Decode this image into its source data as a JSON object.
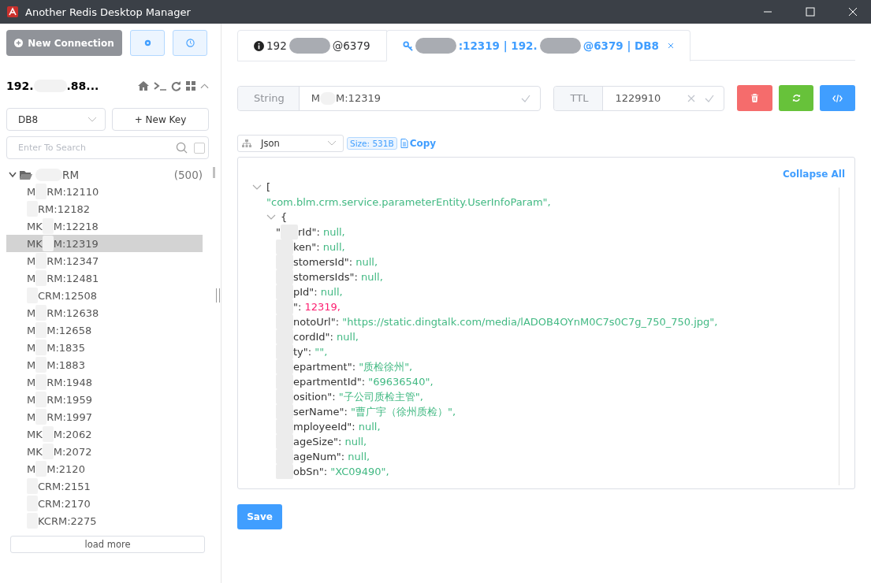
{
  "window": {
    "title": "Another Redis Desktop Manager"
  },
  "sidebar": {
    "new_connection": "New Connection",
    "connection": {
      "name": [
        {
          "kind": "text",
          "text": "192."
        },
        {
          "kind": "redaction",
          "color": "#f2f2f2"
        },
        {
          "kind": "text",
          "text": ".88..."
        }
      ],
      "expanded": true
    },
    "db_select": {
      "value": "DB8"
    },
    "new_key": "+ New Key",
    "search": {
      "placeholder": "Enter To Search",
      "exact": false
    },
    "folder": {
      "name": [
        {
          "kind": "redaction",
          "color": "#f2f2f2"
        },
        {
          "kind": "text",
          "text": "RM"
        }
      ],
      "count": "(500)",
      "expanded": true
    },
    "keys": [
      {
        "name": [
          {
            "kind": "text",
            "text": "M"
          },
          {
            "kind": "redaction",
            "color": "#f2f2f2"
          },
          {
            "kind": "text",
            "text": "RM:12110"
          }
        ],
        "selected": false
      },
      {
        "name": [
          {
            "kind": "redaction",
            "color": "#f2f2f2"
          },
          {
            "kind": "text",
            "text": "RM:12182"
          }
        ],
        "selected": false
      },
      {
        "name": [
          {
            "kind": "text",
            "text": "MK"
          },
          {
            "kind": "redaction",
            "color": "#f2f2f2"
          },
          {
            "kind": "text",
            "text": "M:12218"
          }
        ],
        "selected": false
      },
      {
        "name": [
          {
            "kind": "text",
            "text": "MK"
          },
          {
            "kind": "redaction",
            "color": "#f2f2f2"
          },
          {
            "kind": "text",
            "text": "M:12319"
          }
        ],
        "selected": true
      },
      {
        "name": [
          {
            "kind": "text",
            "text": "M"
          },
          {
            "kind": "redaction",
            "color": "#f2f2f2"
          },
          {
            "kind": "text",
            "text": "RM:12347"
          }
        ],
        "selected": false
      },
      {
        "name": [
          {
            "kind": "text",
            "text": "M"
          },
          {
            "kind": "redaction",
            "color": "#f2f2f2"
          },
          {
            "kind": "text",
            "text": "RM:12481"
          }
        ],
        "selected": false
      },
      {
        "name": [
          {
            "kind": "redaction",
            "color": "#f2f2f2"
          },
          {
            "kind": "text",
            "text": "CRM:12508"
          }
        ],
        "selected": false
      },
      {
        "name": [
          {
            "kind": "text",
            "text": "M"
          },
          {
            "kind": "redaction",
            "color": "#f2f2f2"
          },
          {
            "kind": "text",
            "text": "RM:12638"
          }
        ],
        "selected": false
      },
      {
        "name": [
          {
            "kind": "text",
            "text": "M"
          },
          {
            "kind": "redaction",
            "color": "#f2f2f2"
          },
          {
            "kind": "text",
            "text": "M:12658"
          }
        ],
        "selected": false
      },
      {
        "name": [
          {
            "kind": "text",
            "text": "M"
          },
          {
            "kind": "redaction",
            "color": "#f2f2f2"
          },
          {
            "kind": "text",
            "text": "M:1835"
          }
        ],
        "selected": false
      },
      {
        "name": [
          {
            "kind": "text",
            "text": "M"
          },
          {
            "kind": "redaction",
            "color": "#f2f2f2"
          },
          {
            "kind": "text",
            "text": "M:1883"
          }
        ],
        "selected": false
      },
      {
        "name": [
          {
            "kind": "text",
            "text": "M"
          },
          {
            "kind": "redaction",
            "color": "#f2f2f2"
          },
          {
            "kind": "text",
            "text": "RM:1948"
          }
        ],
        "selected": false
      },
      {
        "name": [
          {
            "kind": "text",
            "text": "M"
          },
          {
            "kind": "redaction",
            "color": "#f2f2f2"
          },
          {
            "kind": "text",
            "text": "RM:1959"
          }
        ],
        "selected": false
      },
      {
        "name": [
          {
            "kind": "text",
            "text": "M"
          },
          {
            "kind": "redaction",
            "color": "#f2f2f2"
          },
          {
            "kind": "text",
            "text": "RM:1997"
          }
        ],
        "selected": false
      },
      {
        "name": [
          {
            "kind": "text",
            "text": "MK"
          },
          {
            "kind": "redaction",
            "color": "#f2f2f2"
          },
          {
            "kind": "text",
            "text": "M:2062"
          }
        ],
        "selected": false
      },
      {
        "name": [
          {
            "kind": "text",
            "text": "MK"
          },
          {
            "kind": "redaction",
            "color": "#f2f2f2"
          },
          {
            "kind": "text",
            "text": "M:2072"
          }
        ],
        "selected": false
      },
      {
        "name": [
          {
            "kind": "text",
            "text": "M"
          },
          {
            "kind": "redaction",
            "color": "#f2f2f2"
          },
          {
            "kind": "text",
            "text": "M:2120"
          }
        ],
        "selected": false
      },
      {
        "name": [
          {
            "kind": "redaction",
            "color": "#f2f2f2"
          },
          {
            "kind": "text",
            "text": "CRM:2151"
          }
        ],
        "selected": false
      },
      {
        "name": [
          {
            "kind": "redaction",
            "color": "#f2f2f2"
          },
          {
            "kind": "text",
            "text": "CRM:2170"
          }
        ],
        "selected": false
      },
      {
        "name": [
          {
            "kind": "redaction",
            "color": "#f2f2f2"
          },
          {
            "kind": "text",
            "text": "KCRM:2275"
          }
        ],
        "selected": false
      }
    ],
    "load_more": "load more"
  },
  "tabs": [
    {
      "kind": "info",
      "label": [
        {
          "kind": "text",
          "text": "192"
        },
        {
          "kind": "redaction",
          "color": "#a9acb2"
        },
        {
          "kind": "text",
          "text": "@6379"
        }
      ],
      "selected": false,
      "closable": false
    },
    {
      "kind": "key",
      "label": [
        {
          "kind": "redaction",
          "color": "#a9acb2"
        },
        {
          "kind": "text",
          "text": ":12319 | 192."
        },
        {
          "kind": "redaction",
          "color": "#a9acb2"
        },
        {
          "kind": "text",
          "text": "@6379 | DB8"
        }
      ],
      "selected": true,
      "closable": true
    }
  ],
  "key_bar": {
    "type": "String",
    "key": [
      {
        "kind": "text",
        "text": "M"
      },
      {
        "kind": "redaction",
        "color": "#f2f2f2"
      },
      {
        "kind": "text",
        "text": "M:12319"
      }
    ],
    "ttl_label": "TTL",
    "ttl": "1229910"
  },
  "viewer": {
    "format": "Json",
    "size": "Size: 531B",
    "copy": "Copy",
    "collapse_all": "Collapse All",
    "tree": {
      "open": "[",
      "expanded": true,
      "children": [
        {
          "kind": "value",
          "value": "\"com.blm.crm.service.parameterEntity.UserInfoParam\",",
          "color": "#42b983"
        },
        {
          "kind": "object",
          "open": "{",
          "expanded": true,
          "children": [
            {
              "kind": "entry",
              "key": [
                {
                  "kind": "text",
                  "text": "\""
                },
                {
                  "kind": "redaction",
                  "color": "#ececec"
                },
                {
                  "kind": "text",
                  "text": "rId\":"
                }
              ],
              "value": "null,",
              "color": "#42b983"
            },
            {
              "kind": "entry",
              "key": [
                {
                  "kind": "redaction",
                  "color": "#ececec"
                },
                {
                  "kind": "text",
                  "text": "ken\":"
                }
              ],
              "value": "null,",
              "color": "#42b983"
            },
            {
              "kind": "entry",
              "key": [
                {
                  "kind": "redaction",
                  "color": "#ececec"
                },
                {
                  "kind": "text",
                  "text": "stomersId\":"
                }
              ],
              "value": "null,",
              "color": "#42b983"
            },
            {
              "kind": "entry",
              "key": [
                {
                  "kind": "redaction",
                  "color": "#ececec"
                },
                {
                  "kind": "text",
                  "text": "stomersIds\":"
                }
              ],
              "value": "null,",
              "color": "#42b983"
            },
            {
              "kind": "entry",
              "key": [
                {
                  "kind": "redaction",
                  "color": "#ececec"
                },
                {
                  "kind": "text",
                  "text": "pId\":"
                }
              ],
              "value": "null,",
              "color": "#42b983"
            },
            {
              "kind": "entry",
              "key": [
                {
                  "kind": "redaction",
                  "color": "#ececec"
                },
                {
                  "kind": "text",
                  "text": "\":"
                }
              ],
              "value": "12319,",
              "color": "#fc1e70"
            },
            {
              "kind": "entry",
              "key": [
                {
                  "kind": "redaction",
                  "color": "#ececec"
                },
                {
                  "kind": "text",
                  "text": "notoUrl\":"
                }
              ],
              "value": "\"https://static.dingtalk.com/media/lADOB4OYnM0C7s0C7g_750_750.jpg\",",
              "color": "#42b983"
            },
            {
              "kind": "entry",
              "key": [
                {
                  "kind": "redaction",
                  "color": "#ececec"
                },
                {
                  "kind": "text",
                  "text": "cordId\":"
                }
              ],
              "value": "null,",
              "color": "#42b983"
            },
            {
              "kind": "entry",
              "key": [
                {
                  "kind": "redaction",
                  "color": "#ececec"
                },
                {
                  "kind": "text",
                  "text": "ty\":"
                }
              ],
              "value": "\"\",",
              "color": "#42b983"
            },
            {
              "kind": "entry",
              "key": [
                {
                  "kind": "redaction",
                  "color": "#ececec"
                },
                {
                  "kind": "text",
                  "text": "epartment\":"
                }
              ],
              "value": "\"质检徐州\",",
              "color": "#42b983"
            },
            {
              "kind": "entry",
              "key": [
                {
                  "kind": "redaction",
                  "color": "#ececec"
                },
                {
                  "kind": "text",
                  "text": "epartmentId\":"
                }
              ],
              "value": "\"69636540\",",
              "color": "#42b983"
            },
            {
              "kind": "entry",
              "key": [
                {
                  "kind": "redaction",
                  "color": "#ececec"
                },
                {
                  "kind": "text",
                  "text": "osition\":"
                }
              ],
              "value": "\"子公司质检主管\",",
              "color": "#42b983"
            },
            {
              "kind": "entry",
              "key": [
                {
                  "kind": "redaction",
                  "color": "#ececec"
                },
                {
                  "kind": "text",
                  "text": "serName\":"
                }
              ],
              "value": "\"曹广宇（徐州质检）\",",
              "color": "#42b983"
            },
            {
              "kind": "entry",
              "key": [
                {
                  "kind": "redaction",
                  "color": "#ececec"
                },
                {
                  "kind": "text",
                  "text": "mployeeId\":"
                }
              ],
              "value": "null,",
              "color": "#42b983"
            },
            {
              "kind": "entry",
              "key": [
                {
                  "kind": "redaction",
                  "color": "#ececec"
                },
                {
                  "kind": "text",
                  "text": "ageSize\":"
                }
              ],
              "value": "null,",
              "color": "#42b983"
            },
            {
              "kind": "entry",
              "key": [
                {
                  "kind": "redaction",
                  "color": "#ececec"
                },
                {
                  "kind": "text",
                  "text": "ageNum\":"
                }
              ],
              "value": "null,",
              "color": "#42b983"
            },
            {
              "kind": "entry",
              "key": [
                {
                  "kind": "redaction",
                  "color": "#ececec"
                },
                {
                  "kind": "text",
                  "text": "obSn\":"
                }
              ],
              "value": "\"XC09490\",",
              "color": "#42b983"
            }
          ]
        }
      ]
    }
  },
  "save": "Save"
}
